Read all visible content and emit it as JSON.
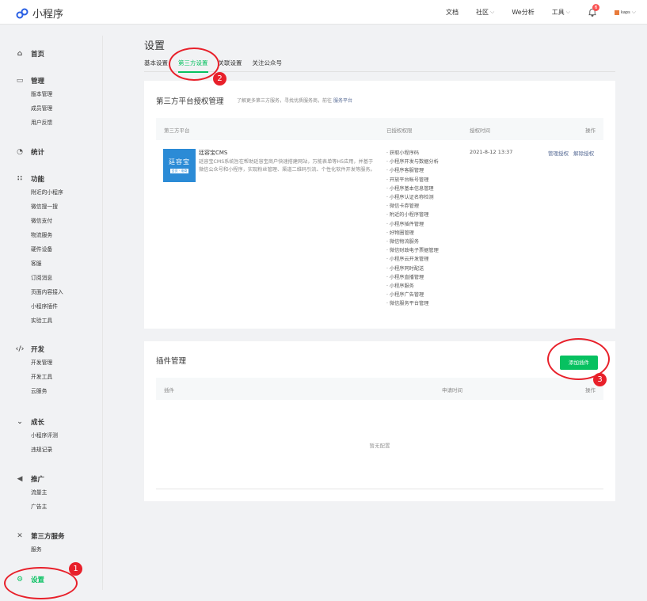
{
  "topbar": {
    "app_title": "小程序",
    "nav": {
      "docs": "文档",
      "community": "社区",
      "we_analysis": "We分析",
      "tools": "工具"
    },
    "notification_count": "6",
    "user_name": "kaps"
  },
  "sidebar": {
    "home": "首页",
    "manage": {
      "title": "管理",
      "items": [
        "版本管理",
        "成员管理",
        "用户反馈"
      ]
    },
    "stats": "统计",
    "features": {
      "title": "功能",
      "items": [
        "附近的小程序",
        "微信搜一搜",
        "微信支付",
        "物流服务",
        "硬件设备",
        "客服",
        "订阅消息",
        "页面内容接入",
        "小程序插件",
        "实验工具"
      ]
    },
    "dev": {
      "title": "开发",
      "items": [
        "开发管理",
        "开发工具",
        "云服务"
      ]
    },
    "growth": {
      "title": "成长",
      "items": [
        "小程序评测",
        "违规记录"
      ]
    },
    "promo": {
      "title": "推广",
      "items": [
        "流量主",
        "广告主"
      ]
    },
    "third_party": {
      "title": "第三方服务",
      "items": [
        "服务"
      ]
    },
    "settings": "设置"
  },
  "main": {
    "title": "设置",
    "tabs": [
      "基本设置",
      "第三方设置",
      "关联设置",
      "关注公众号"
    ],
    "auth_card": {
      "title": "第三方平台授权管理",
      "desc": "了解更多第三方服务，寻找优质服务商，前往",
      "desc_link": "服务平台",
      "columns": [
        "第三方平台",
        "已授权权限",
        "授权时间",
        "操作"
      ],
      "app": {
        "logo_text": "廷容宝",
        "logo_sub": "会员 · 电商",
        "name": "廷容宝CMS",
        "desc": "廷容宝CMS系统旨在帮助廷容宝商户快速搭建网站，万能表单等H5应用，并基于微信公众号和小程序，实现粉丝管理、渠道二维码引流、个性化软件开发等服务。",
        "permissions": [
          "· 获取小程序码",
          "· 小程序开发与数据分析",
          "· 小程序客服管理",
          "· 开放平台帐号管理",
          "· 小程序基本信息管理",
          "· 小程序认证名称检测",
          "· 微信卡券管理",
          "· 附近的小程序管理",
          "· 小程序插件管理",
          "· 好物圈管理",
          "· 微信物流服务",
          "· 微信财政电子票据管理",
          "· 小程序云开发管理",
          "· 小程序同时配送",
          "· 小程序直播管理",
          "· 小程序服务",
          "· 小程序广告管理",
          "· 微信服务平台管理"
        ],
        "auth_time": "2021-8-12 13:37",
        "actions": [
          "管理授权",
          "解除授权"
        ]
      }
    },
    "plugin_card": {
      "title": "插件管理",
      "add_button": "添加插件",
      "columns": [
        "插件",
        "申请时间",
        "操作"
      ],
      "empty": "暂无配置"
    }
  },
  "annotations": [
    "1",
    "2",
    "3"
  ],
  "colors": {
    "accent": "#07c160",
    "link": "#576b95",
    "annotation": "#e8202a"
  }
}
